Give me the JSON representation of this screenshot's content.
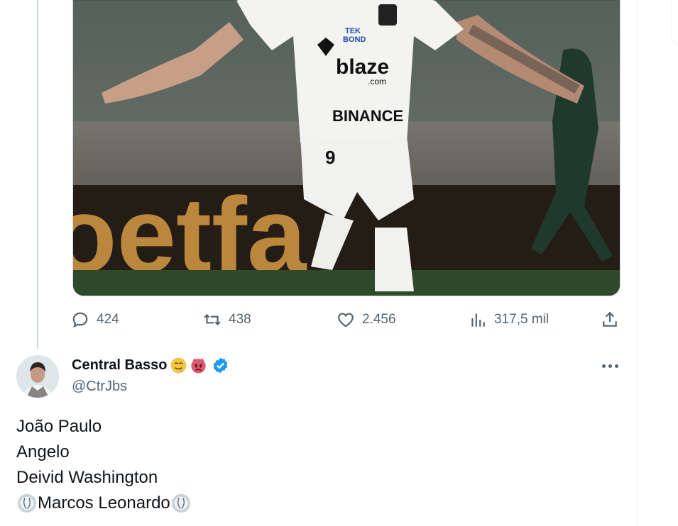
{
  "tweet": {
    "media_alt": "Jogador do Santos comemorando gol",
    "actions": {
      "replies": "424",
      "retweets": "438",
      "likes": "2.456",
      "views": "317,5 mil"
    }
  },
  "reply": {
    "author_name": "Central Basso",
    "author_emojis": [
      "drooling-face-emoji",
      "angry-face-emoji"
    ],
    "verified": true,
    "handle": "@CtrJbs",
    "lines": [
      "João Paulo",
      "Angelo",
      "Deivid Washington",
      "Marcos Leonardo"
    ],
    "line_icon": "soccer-ball-emoji"
  },
  "colors": {
    "text_primary": "#0f1419",
    "text_secondary": "#536471",
    "verified_blue": "#1d9bf0",
    "border": "#cfd9de"
  }
}
